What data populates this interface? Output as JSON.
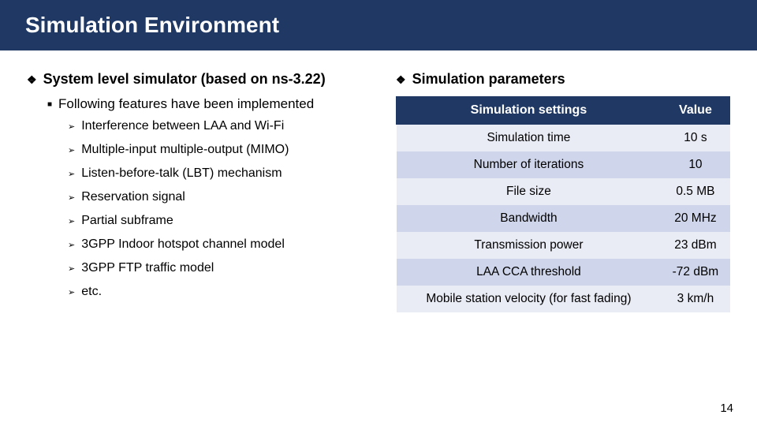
{
  "title": "Simulation Environment",
  "left": {
    "heading": "System level simulator (based on ns-3.22)",
    "subheading": "Following features have been implemented",
    "features": [
      "Interference between LAA and Wi-Fi",
      "Multiple-input multiple-output (MIMO)",
      "Listen-before-talk (LBT) mechanism",
      "Reservation signal",
      "Partial subframe",
      "3GPP Indoor hotspot channel model",
      "3GPP FTP traffic model",
      "etc."
    ]
  },
  "right": {
    "heading": "Simulation parameters",
    "table": {
      "headers": [
        "Simulation settings",
        "Value"
      ],
      "rows": [
        [
          "Simulation time",
          "10 s"
        ],
        [
          "Number of iterations",
          "10"
        ],
        [
          "File size",
          "0.5 MB"
        ],
        [
          "Bandwidth",
          "20 MHz"
        ],
        [
          "Transmission power",
          "23 dBm"
        ],
        [
          "LAA CCA threshold",
          "-72 dBm"
        ],
        [
          "Mobile station velocity (for fast fading)",
          "3 km/h"
        ]
      ]
    }
  },
  "page_number": "14"
}
